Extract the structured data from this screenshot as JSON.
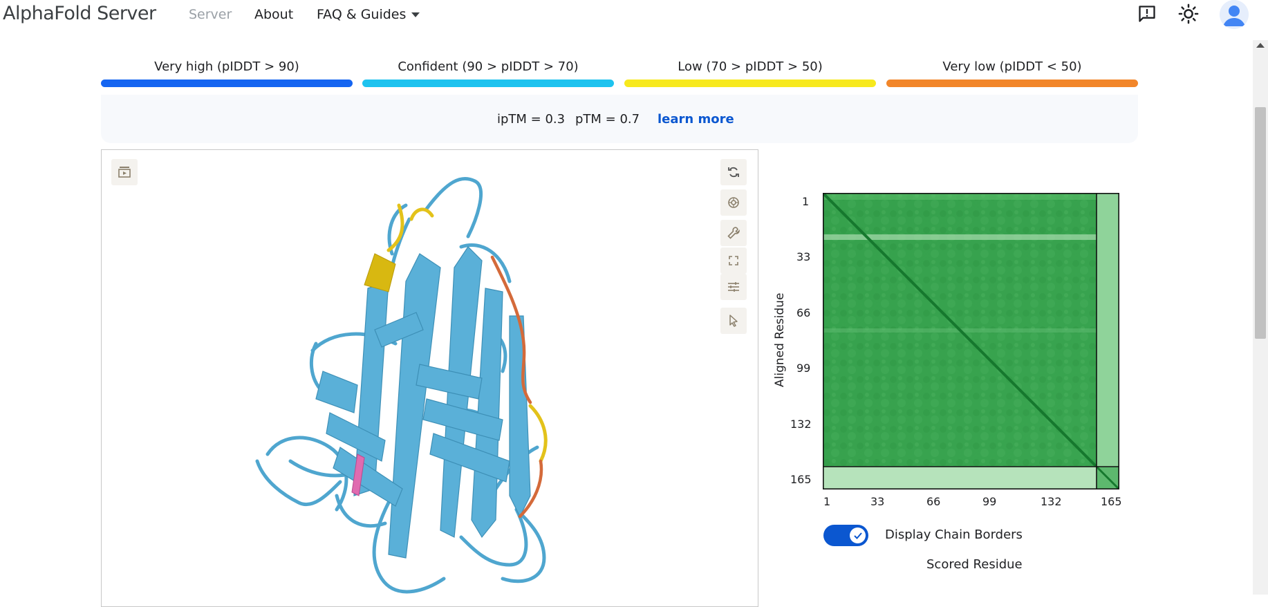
{
  "header": {
    "brand": "AlphaFold Server",
    "nav": [
      {
        "label": "Server"
      },
      {
        "label": "About"
      },
      {
        "label": "FAQ & Guides"
      }
    ]
  },
  "legend": [
    {
      "label": "Very high (pIDDT > 90)",
      "color": "#1565f1"
    },
    {
      "label": "Confident (90 > pIDDT > 70)",
      "color": "#1ec3ef"
    },
    {
      "label": "Low (70 > pIDDT > 50)",
      "color": "#f7e91d"
    },
    {
      "label": "Very low (pIDDT < 50)",
      "color": "#f2862a"
    }
  ],
  "metrics": {
    "iptm": "ipTM = 0.3",
    "ptm": "pTM = 0.7",
    "learn_more": "learn more"
  },
  "pae": {
    "y_title": "Aligned Residue",
    "x_title": "Scored Residue",
    "ticks": [
      "1",
      "33",
      "66",
      "99",
      "132",
      "165"
    ],
    "toggle_label": "Display Chain Borders",
    "toggle_on": true
  },
  "colors": {
    "accent": "#0b57d0",
    "structure_blue": "#5aafd6",
    "structure_yellow": "#e3c21a",
    "structure_orange": "#d46a3a",
    "pae_green": "#2e9b4a"
  }
}
